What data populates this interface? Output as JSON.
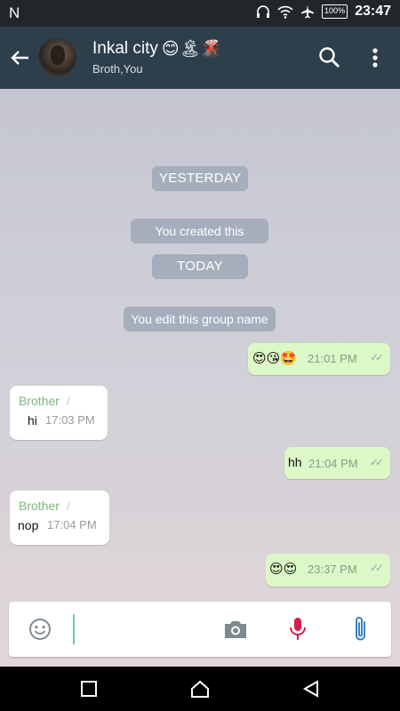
{
  "status_bar": {
    "carrier": "N",
    "battery": "100%",
    "time": "23:47"
  },
  "header": {
    "title": "Inkal city",
    "title_emojis": "😊🏝🌋",
    "subtitle": "Broth,You"
  },
  "messages": {
    "date_yesterday": "YESTERDAY",
    "system_created": "You created this group",
    "date_today": "TODAY",
    "system_edit": "You edit this group name",
    "m1": {
      "text": "😍😘🤩",
      "time": "21:01 PM"
    },
    "m2": {
      "sender": "Brother",
      "text": "hi",
      "time": "17:03 PM"
    },
    "m3": {
      "text": "hh",
      "time": "21:04 PM"
    },
    "m4": {
      "sender": "Brother",
      "text": "nop",
      "time": "17:04 PM"
    },
    "m5": {
      "text": "😍😍",
      "time": "23:37 PM"
    }
  },
  "input": {
    "value": "",
    "placeholder": ""
  },
  "colors": {
    "app_bar": "#2e3f4c",
    "status_bar": "#222629",
    "outgoing_bubble": "#dcf8c6",
    "incoming_bubble": "#ffffff",
    "sender_name": "#7cb77f",
    "mic": "#d6204b",
    "attach": "#3a7fc1"
  },
  "icons": {
    "back": "arrow-left-icon",
    "search": "search-icon",
    "menu": "more-vert-icon",
    "emoji": "emoji-icon",
    "camera": "camera-icon",
    "mic": "mic-icon",
    "attach": "paperclip-icon",
    "nav_recents": "square-icon",
    "nav_home": "home-icon",
    "nav_back": "triangle-back-icon"
  }
}
